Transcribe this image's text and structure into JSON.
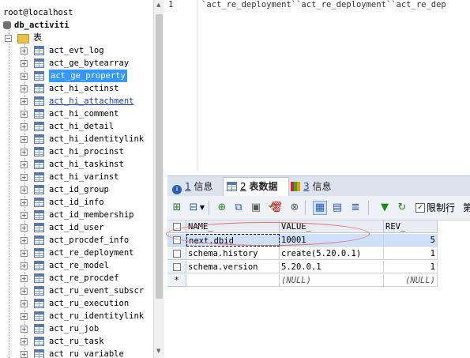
{
  "tree": {
    "connection": "root@localhost",
    "database": "db_activiti",
    "folder": "表",
    "tables": [
      "act_evt_log",
      "act_ge_bytearray",
      "act_ge_property",
      "act_hi_actinst",
      "act_hi_attachment",
      "act_hi_comment",
      "act_hi_detail",
      "act_hi_identitylink",
      "act_hi_procinst",
      "act_hi_taskinst",
      "act_hi_varinst",
      "act_id_group",
      "act_id_info",
      "act_id_membership",
      "act_id_user",
      "act_procdef_info",
      "act_re_deployment",
      "act_re_model",
      "act_re_procdef",
      "act_ru_event_subscr",
      "act_ru_execution",
      "act_ru_identitylink",
      "act_ru_job",
      "act_ru_task",
      "act_ru_variable"
    ],
    "selected_table": "act_ge_property",
    "linked_table": "act_hi_attachment"
  },
  "editor": {
    "line_number": "1",
    "code": "`act_re_deployment``act_re_deployment``act_re_dep"
  },
  "tabs": [
    {
      "num": "1",
      "label": "信息",
      "icon": "info-icon"
    },
    {
      "num": "2",
      "label": "表数据",
      "icon": "table-data-icon"
    },
    {
      "num": "3",
      "label": "信息",
      "icon": "info-chart-icon"
    }
  ],
  "toolbar": {
    "limit_rows_label": "限制行",
    "trailing_label": "第"
  },
  "grid": {
    "columns": [
      "NAME_",
      "VALUE_",
      "REV_"
    ],
    "rows": [
      [
        "next.dbid",
        "10001",
        "5"
      ],
      [
        "schema.history",
        "create(5.20.0.1)",
        "1"
      ],
      [
        "schema.version",
        "5.20.0.1",
        "1"
      ]
    ],
    "new_row_marker": "*",
    "null_text": "(NULL)"
  },
  "colors": {
    "selection": "#3399ff",
    "annotation": "#e07070",
    "header_bg": "#e9edf2"
  }
}
